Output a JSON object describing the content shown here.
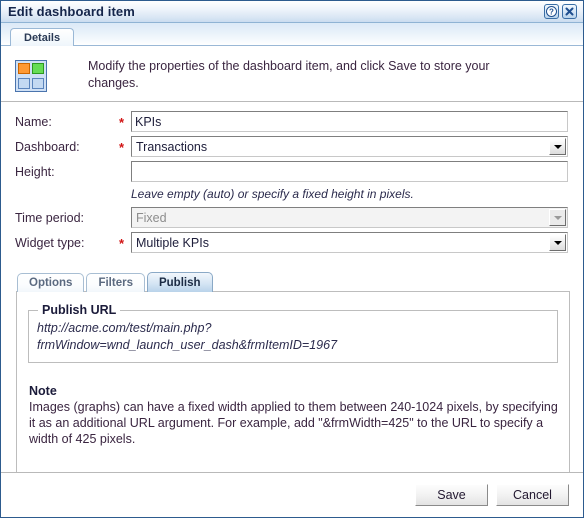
{
  "window": {
    "title": "Edit dashboard item",
    "help_icon": "question-mark-icon",
    "close_icon": "close-x-icon"
  },
  "top_tabs": [
    {
      "label": "Details",
      "active": true
    }
  ],
  "instruction": {
    "icon": "dashboard-grid-icon",
    "text": "Modify the properties of the dashboard item, and click Save to store your changes."
  },
  "form": {
    "required_marker": "*",
    "fields": [
      {
        "label": "Name:",
        "required": true,
        "type": "text",
        "value": "KPIs"
      },
      {
        "label": "Dashboard:",
        "required": true,
        "type": "select",
        "value": "Transactions",
        "disabled": false
      },
      {
        "label": "Height:",
        "required": false,
        "type": "text",
        "value": ""
      },
      {
        "label": "Time period:",
        "required": false,
        "type": "select",
        "value": "Fixed",
        "disabled": true
      },
      {
        "label": "Widget type:",
        "required": true,
        "type": "select",
        "value": "Multiple KPIs",
        "disabled": false
      }
    ],
    "height_hint": "Leave empty (auto) or specify a fixed height in pixels."
  },
  "inner_tabs": [
    {
      "label": "Options",
      "active": false
    },
    {
      "label": "Filters",
      "active": false
    },
    {
      "label": "Publish",
      "active": true
    }
  ],
  "publish": {
    "url_legend": "Publish URL",
    "url_line1": "http://acme.com/test/main.php?",
    "url_line2": "frmWindow=wnd_launch_user_dash&frmItemID=1967",
    "note_title": "Note",
    "note_body": "Images (graphs) can have a fixed width applied to them between 240-1024 pixels, by specifying it as an additional URL argument. For example, add \"&frmWidth=425\" to the URL to specify a width of 425 pixels."
  },
  "footer": {
    "save_label": "Save",
    "cancel_label": "Cancel"
  },
  "colors": {
    "title_text": "#15264b",
    "required_star": "#d11414",
    "dialog_border": "#2d5b8e",
    "active_tab": "#b9d3ea",
    "icon_orange": "#ff9933",
    "icon_green": "#66dd55",
    "icon_blue": "#c3d9f2"
  }
}
